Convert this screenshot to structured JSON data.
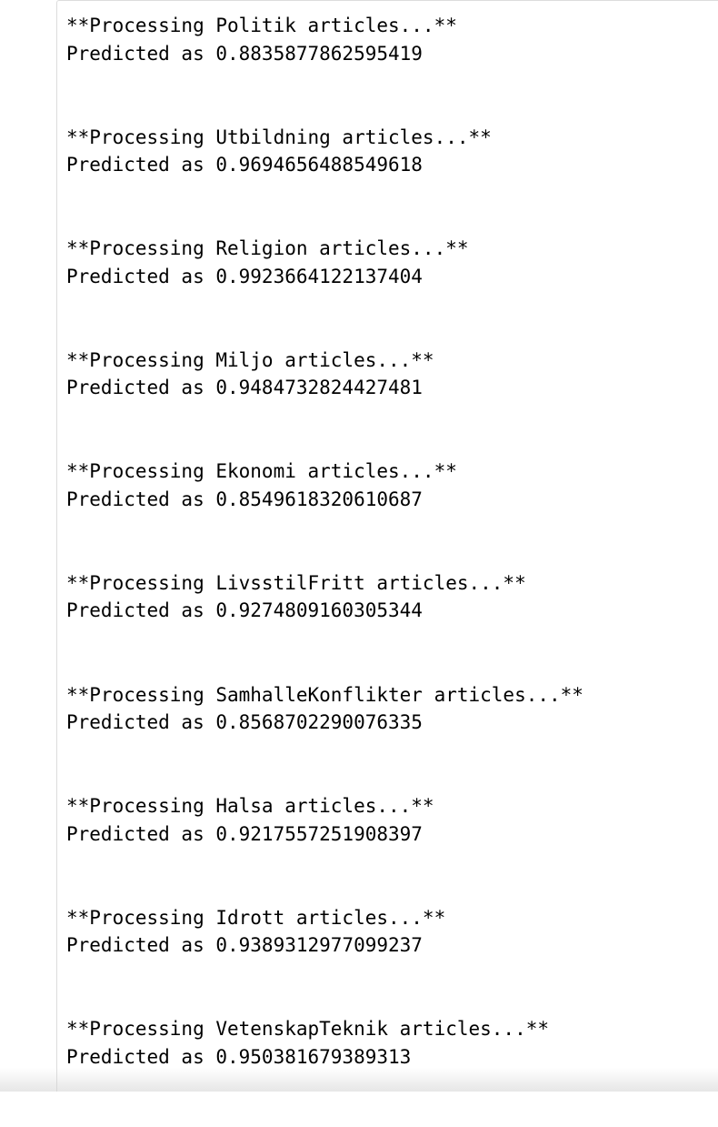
{
  "output": {
    "blocks": [
      {
        "processing": "**Processing Politik articles...**",
        "predicted": "Predicted as 0.8835877862595419"
      },
      {
        "processing": "**Processing Utbildning articles...**",
        "predicted": "Predicted as 0.9694656488549618"
      },
      {
        "processing": "**Processing Religion articles...**",
        "predicted": "Predicted as 0.9923664122137404"
      },
      {
        "processing": "**Processing Miljo articles...**",
        "predicted": "Predicted as 0.9484732824427481"
      },
      {
        "processing": "**Processing Ekonomi articles...**",
        "predicted": "Predicted as 0.8549618320610687"
      },
      {
        "processing": "**Processing LivsstilFritt articles...**",
        "predicted": "Predicted as 0.9274809160305344"
      },
      {
        "processing": "**Processing SamhalleKonflikter articles...**",
        "predicted": "Predicted as 0.8568702290076335"
      },
      {
        "processing": "**Processing Halsa articles...**",
        "predicted": "Predicted as 0.9217557251908397"
      },
      {
        "processing": "**Processing Idrott articles...**",
        "predicted": "Predicted as 0.9389312977099237"
      },
      {
        "processing": "**Processing VetenskapTeknik articles...**",
        "predicted": "Predicted as 0.950381679389313"
      }
    ]
  }
}
